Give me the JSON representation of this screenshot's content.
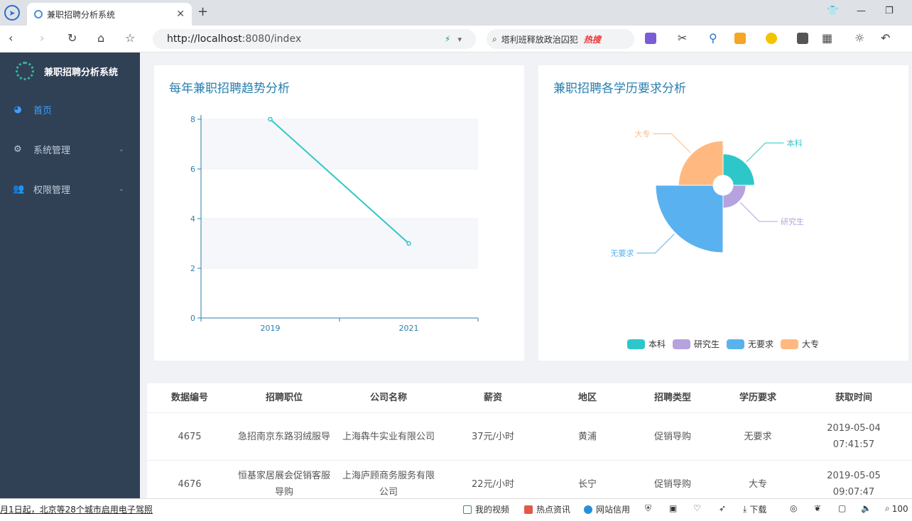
{
  "browser": {
    "tab_title": "兼职招聘分析系统",
    "url_host": "http://localhost",
    "url_rest": ":8080/index",
    "search_text": "塔利班释放政治囚犯",
    "search_hot": "热搜"
  },
  "sidebar": {
    "brand": "兼职招聘分析系统",
    "items": [
      {
        "label": "首页"
      },
      {
        "label": "系统管理"
      },
      {
        "label": "权限管理"
      }
    ]
  },
  "line_card": {
    "title": "每年兼职招聘趋势分析"
  },
  "pie_card": {
    "title": "兼职招聘各学历要求分析"
  },
  "chart_data": [
    {
      "type": "line",
      "categories": [
        "2019",
        "2021"
      ],
      "values": [
        8,
        3
      ],
      "ylim": [
        0,
        8
      ],
      "yticks": [
        "0",
        "2",
        "4",
        "6",
        "8"
      ],
      "color": "#2ec7c9"
    },
    {
      "type": "pie",
      "subtype": "rose",
      "labels": [
        "本科",
        "研究生",
        "无要求",
        "大专"
      ],
      "values": [
        14,
        5,
        100,
        36
      ],
      "colors": [
        "#2ec7c9",
        "#b6a2de",
        "#5ab1ef",
        "#ffb980"
      ],
      "legend": "bottom"
    }
  ],
  "table": {
    "headers": [
      "数据编号",
      "招聘职位",
      "公司名称",
      "薪资",
      "地区",
      "招聘类型",
      "学历要求",
      "获取时间"
    ],
    "rows": [
      [
        "4675",
        "急招南京东路羽绒服导",
        "上海犇牛实业有限公司",
        "37元/小时",
        "黄浦",
        "促销导购",
        "无要求",
        "2019-05-04 07:41:57"
      ],
      [
        "4676",
        "恒基家居展会促销客服导购",
        "上海庐顾商务服务有限公司",
        "22元/小时",
        "长宁",
        "促销导购",
        "大专",
        "2019-05-05 09:07:47"
      ]
    ]
  },
  "statusbar": {
    "news": "月1日起，北京等28个城市启用电子驾照",
    "items": [
      "我的视频",
      "热点资讯",
      "网站信用",
      "下载",
      "100"
    ]
  }
}
